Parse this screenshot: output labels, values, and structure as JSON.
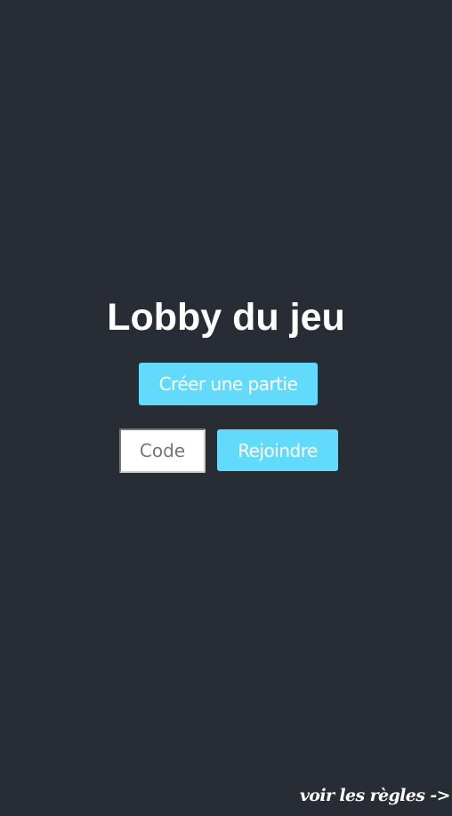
{
  "lobby": {
    "title": "Lobby du jeu",
    "create_button_label": "Créer une partie",
    "code_input": {
      "placeholder": "Code",
      "value": ""
    },
    "join_button_label": "Rejoindre"
  },
  "footer": {
    "rules_link_label": "voir les règles",
    "rules_arrow": "->"
  },
  "colors": {
    "background": "#282c34",
    "accent": "#61dafb",
    "text": "#ffffff"
  }
}
